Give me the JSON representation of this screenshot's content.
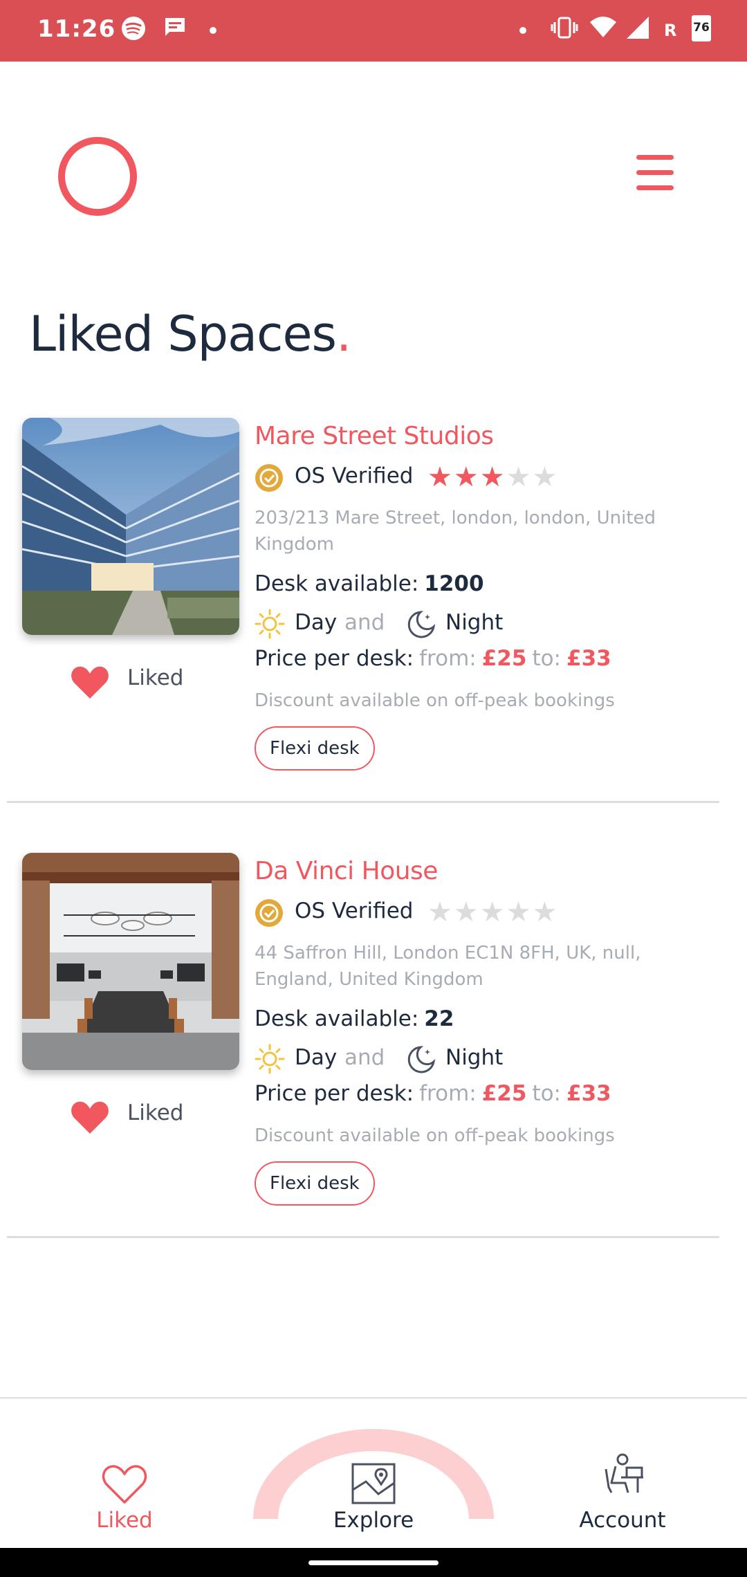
{
  "status_bar": {
    "time": "11:26",
    "network_label": "R",
    "battery": "76"
  },
  "page": {
    "title": "Liked Spaces",
    "title_dot": "."
  },
  "colors": {
    "accent": "#f0575f",
    "status_bar": "#d94f54",
    "text_dark": "#1e2a3d",
    "muted": "#a7abb3",
    "star_empty": "#dcdcdc",
    "verified_badge": "#e3a83a",
    "sun": "#f3c33d"
  },
  "spaces": [
    {
      "name": "Mare Street Studios",
      "verified_label": "OS Verified",
      "rating": 3,
      "max_rating": 5,
      "address": "203/213 Mare Street, london, london, United Kingdom",
      "desk_label": "Desk available:",
      "desk_count": "1200",
      "day_label": "Day",
      "and_label": "and",
      "night_label": "Night",
      "price_label": "Price per desk:",
      "from_label": "from:",
      "price_from": "£25",
      "to_label": "to:",
      "price_to": "£33",
      "discount": "Discount available on off-peak bookings",
      "tag": "Flexi desk",
      "liked_label": "Liked",
      "image": "modern-glass-office-building"
    },
    {
      "name": "Da Vinci House",
      "verified_label": "OS Verified",
      "rating": 0,
      "max_rating": 5,
      "address": "44 Saffron Hill, London EC1N 8FH, UK, null, England, United Kingdom",
      "desk_label": "Desk available:",
      "desk_count": "22",
      "day_label": "Day",
      "and_label": "and",
      "night_label": "Night",
      "price_label": "Price per desk:",
      "from_label": "from:",
      "price_from": "£25",
      "to_label": "to:",
      "price_to": "£33",
      "discount": "Discount available on off-peak bookings",
      "tag": "Flexi desk",
      "liked_label": "Liked",
      "image": "open-plan-office-interior"
    }
  ],
  "bottom_nav": {
    "items": [
      {
        "label": "Liked",
        "icon": "heart-outline-icon",
        "active": true
      },
      {
        "label": "Explore",
        "icon": "map-icon",
        "active": false
      },
      {
        "label": "Account",
        "icon": "desk-chair-icon",
        "active": false
      }
    ]
  }
}
